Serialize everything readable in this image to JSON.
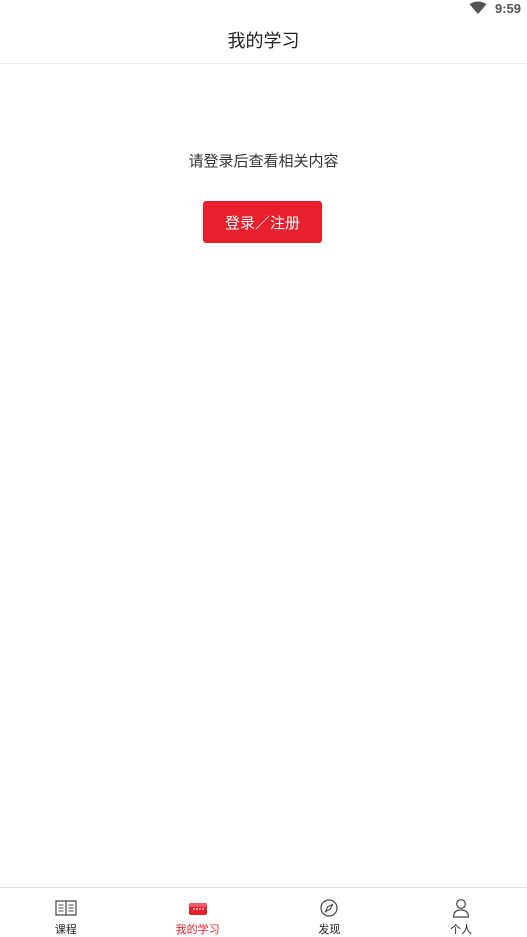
{
  "status_bar": {
    "time": "9:59",
    "icons": [
      "wifi-icon"
    ]
  },
  "header": {
    "title": "我的学习"
  },
  "main": {
    "prompt": "请登录后查看相关内容",
    "login_button_label": "登录／注册"
  },
  "tab_bar": {
    "tabs": [
      {
        "label": "课程",
        "icon": "book-icon",
        "active": false
      },
      {
        "label": "我的学习",
        "icon": "study-icon",
        "active": true
      },
      {
        "label": "发现",
        "icon": "compass-icon",
        "active": false
      },
      {
        "label": "个人",
        "icon": "person-icon",
        "active": false
      }
    ]
  },
  "colors": {
    "accent": "#e8202c",
    "text": "#222222",
    "divider": "#ececec"
  }
}
